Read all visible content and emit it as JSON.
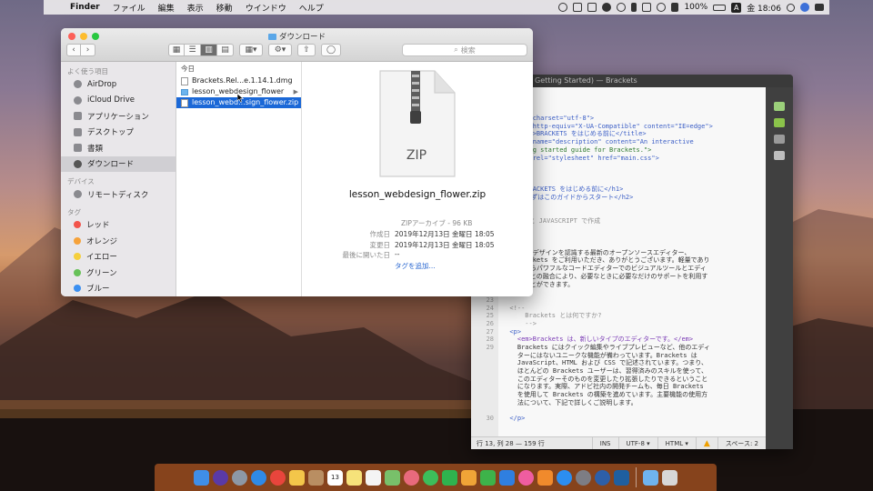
{
  "menubar": {
    "app": "Finder",
    "items": [
      "ファイル",
      "編集",
      "表示",
      "移動",
      "ウインドウ",
      "ヘルプ"
    ],
    "battery": "100%",
    "input_source": "A",
    "clock": "金 18:06"
  },
  "brackets": {
    "title": "Getting Started) — Brackets",
    "lines": [
      {
        "n": "",
        "t": "PE html>",
        "c": "tag"
      },
      {
        "n": "",
        "t": "",
        "c": ""
      },
      {
        "n": "",
        "t": "ad>",
        "c": "tag"
      },
      {
        "n": "",
        "t": "  <meta charset=\"utf-8\">",
        "c": "tag"
      },
      {
        "n": "",
        "t": "  <meta http-equiv=\"X-UA-Compatible\" content=\"IE=edge\">",
        "c": "tag"
      },
      {
        "n": "",
        "t": "  <title>BRACKETS をはじめる前に</title>",
        "c": "tag"
      },
      {
        "n": "",
        "t": "  <meta name=\"description\" content=\"An interactive",
        "c": "tag"
      },
      {
        "n": "",
        "t": "  getting started guide for Brackets.\">",
        "c": "str"
      },
      {
        "n": "",
        "t": "  <link rel=\"stylesheet\" href=\"main.css\">",
        "c": "tag"
      },
      {
        "n": "",
        "t": "ead>",
        "c": "tag"
      },
      {
        "n": "",
        "t": "dy>",
        "c": "tag"
      },
      {
        "n": "",
        "t": "",
        "c": ""
      },
      {
        "n": "",
        "t": "  <h1>BRACKETS をはじめる前に</h1>",
        "c": "tag"
      },
      {
        "n": "",
        "t": "  <h2>まずはこのガイドからスタート</h2>",
        "c": "tag"
      },
      {
        "n": "",
        "t": "",
        "c": ""
      },
      {
        "n": "",
        "t": "  <!--",
        "c": "cm"
      },
      {
        "n": "",
        "t": "    <3 と JAVASCRIPT で作成",
        "c": "cm"
      },
      {
        "n": "",
        "t": "  -->",
        "c": "cm"
      },
      {
        "n": "",
        "t": "",
        "c": ""
      },
      {
        "n": "",
        "t": "  <p>",
        "c": "tag"
      },
      {
        "n": "",
        "t": "    Web デザインを認識する最新のオープンソースエディター、",
        "c": ""
      },
      {
        "n": "",
        "t": "    Brackets をご利用いただき、ありがとうございます。軽量であり",
        "c": ""
      },
      {
        "n": "",
        "t": "    ながらパワフルなコードエディターでのビジュアルツールとエディ",
        "c": ""
      },
      {
        "n": "",
        "t": "    ターとの融合により、必要なときに必要なだけのサポートを利用す",
        "c": ""
      },
      {
        "n": "",
        "t": "    ることができます。",
        "c": ""
      },
      {
        "n": "",
        "t": "  </p>",
        "c": "tag"
      },
      {
        "n": "23",
        "t": "",
        "c": ""
      },
      {
        "n": "24",
        "t": "  <!--",
        "c": "cm"
      },
      {
        "n": "25",
        "t": "      Brackets とは何ですか?",
        "c": "cm"
      },
      {
        "n": "26",
        "t": "      -->",
        "c": "cm"
      },
      {
        "n": "27",
        "t": "  <p>",
        "c": "tag"
      },
      {
        "n": "28",
        "t": "    <em>Brackets は、新しいタイプのエディターです。</em>",
        "c": "em"
      },
      {
        "n": "29",
        "t": "    Brackets にはクイック編集やライブプレビューなど、他のエディ",
        "c": ""
      },
      {
        "n": "",
        "t": "    ターにはないユニークな機能が備わっています。Brackets は",
        "c": ""
      },
      {
        "n": "",
        "t": "    JavaScript、HTML および CSS で記述されています。つまり、",
        "c": ""
      },
      {
        "n": "",
        "t": "    ほとんどの Brackets ユーザーは、習得済みのスキルを使って、",
        "c": ""
      },
      {
        "n": "",
        "t": "    このエディターそのものを変更したり拡張したりできるということ",
        "c": ""
      },
      {
        "n": "",
        "t": "    になります。実際、アドビ社内の開発チームも、毎日 Brackets",
        "c": ""
      },
      {
        "n": "",
        "t": "    を使用して Brackets の構築を進めています。主要機能の使用方",
        "c": ""
      },
      {
        "n": "",
        "t": "    法について、下記で詳しくご説明します。",
        "c": ""
      },
      {
        "n": "",
        "t": "",
        "c": ""
      },
      {
        "n": "30",
        "t": "  </p>",
        "c": "tag"
      }
    ],
    "status": {
      "position": "行 13, 列 28 — 159 行",
      "mode": "INS",
      "encoding": "UTF-8 ▾",
      "language": "HTML ▾",
      "spaces": "スペース: 2"
    }
  },
  "finder": {
    "title": "ダウンロード",
    "search_placeholder": "検索",
    "sidebar": {
      "favorites_header": "よく使う項目",
      "favorites": [
        "AirDrop",
        "iCloud Drive",
        "アプリケーション",
        "デスクトップ",
        "書類",
        "ダウンロード"
      ],
      "devices_header": "デバイス",
      "devices": [
        "リモートディスク"
      ],
      "tags_header": "タグ",
      "tags": [
        {
          "label": "レッド",
          "color": "#f2544b"
        },
        {
          "label": "オレンジ",
          "color": "#f6a23a"
        },
        {
          "label": "イエロー",
          "color": "#f5cf3c"
        },
        {
          "label": "グリーン",
          "color": "#67c158"
        },
        {
          "label": "ブルー",
          "color": "#3b8ff1"
        }
      ]
    },
    "column_header": "今日",
    "files": [
      {
        "name": "Brackets.Rel...e.1.14.1.dmg",
        "kind": "file"
      },
      {
        "name": "lesson_webdesign_flower",
        "kind": "folder"
      },
      {
        "name": "lesson_webd...sign_flower.zip",
        "kind": "file",
        "selected": true
      }
    ],
    "preview": {
      "icon_label": "ZIP",
      "name": "lesson_webdesign_flower.zip",
      "kind": "ZIPアーカイブ - 96 KB",
      "rows": [
        {
          "k": "作成日",
          "v": "2019年12月13日 金曜日 18:05"
        },
        {
          "k": "変更日",
          "v": "2019年12月13日 金曜日 18:05"
        },
        {
          "k": "最後に開いた日",
          "v": "--"
        },
        {
          "k": "",
          "v": "タグを追加..."
        }
      ]
    }
  },
  "dock": {
    "calendar_day": "13"
  }
}
